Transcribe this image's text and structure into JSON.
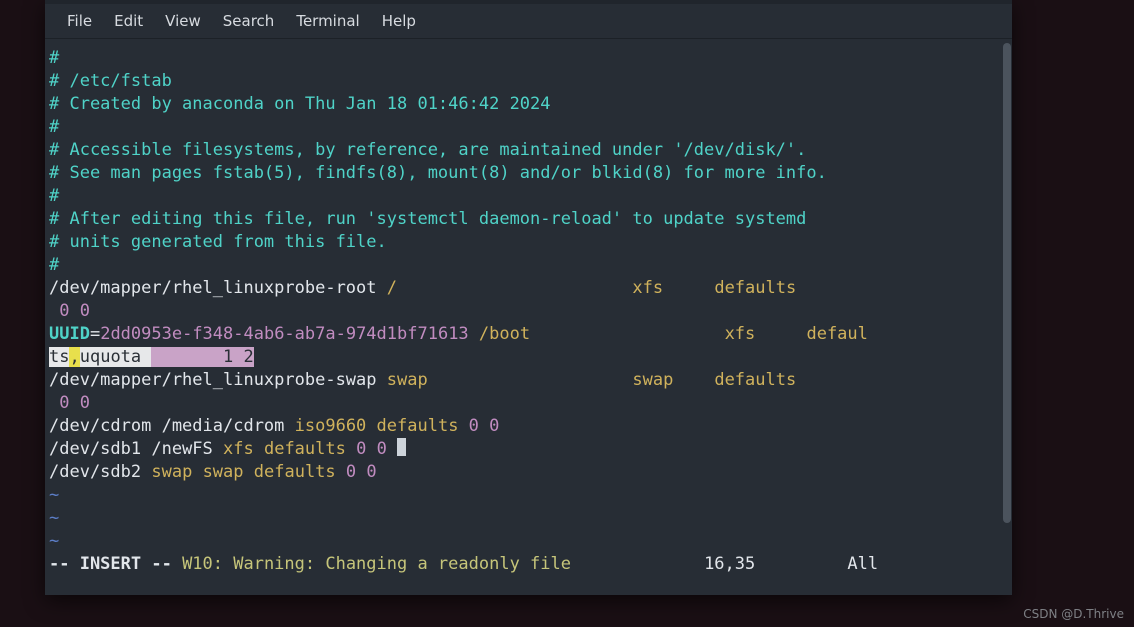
{
  "menu": {
    "file": "File",
    "edit": "Edit",
    "view": "View",
    "search": "Search",
    "terminal": "Terminal",
    "help": "Help"
  },
  "fstab": {
    "c1": "#",
    "c2": "# /etc/fstab",
    "c3": "# Created by anaconda on Thu Jan 18 01:46:42 2024",
    "c4": "#",
    "c5": "# Accessible filesystems, by reference, are maintained under '/dev/disk/'.",
    "c6": "# See man pages fstab(5), findfs(8), mount(8) and/or blkid(8) for more info.",
    "c7": "#",
    "c8": "# After editing this file, run 'systemctl daemon-reload' to update systemd",
    "c9": "# units generated from this file.",
    "c10": "#",
    "root_dev": "/dev/mapper/rhel_linuxprobe-root ",
    "root_mp": "/",
    "root_gap": "                       ",
    "root_fs": "xfs",
    "root_gap2": "     ",
    "root_opts": "defaults",
    "root_dump": " 0 ",
    "root_pass": "0",
    "uuid_key": "UUID",
    "uuid_eq": "=",
    "uuid_val": "2dd0953e-f348-4ab6-ab7a-974d1bf71613",
    "boot_mp": " /boot",
    "boot_gap": "                   ",
    "boot_fs": "xfs",
    "boot_gap2": "     ",
    "boot_opts_wrap1": "defaul",
    "boot_opts_wrap2a": "ts",
    "boot_opts_comma": ",",
    "boot_opts_wrap2b": "uquota ",
    "boot_dump_sel": "       1 2",
    "swap_dev": "/dev/mapper/rhel_linuxprobe-swap ",
    "swap_mp": "swap",
    "swap_gap": "                    ",
    "swap_fs": "swap",
    "swap_gap2": "    ",
    "swap_opts": "defaults",
    "swap_dump": " 0 ",
    "swap_pass": "0",
    "cdrom": "/dev/cdrom /media/cdrom ",
    "cdrom_fs": "iso9660",
    "cdrom_sp": " ",
    "cdrom_opts": "defaults",
    "cdrom_d1": " 0 ",
    "cdrom_d2": "0",
    "sdb1": "/dev/sdb1 /newFS ",
    "sdb1_fs": "xfs",
    "sdb1_sp": " ",
    "sdb1_opts": "defaults",
    "sdb1_d1": " 0 ",
    "sdb1_d2": "0 ",
    "sdb2": "/dev/sdb2 ",
    "sdb2_mp": "swap",
    "sdb2_sp": " ",
    "sdb2_fs": "swap",
    "sdb2_sp2": " ",
    "sdb2_opts": "defaults",
    "sdb2_d1": " 0 ",
    "sdb2_d2": "0",
    "tilde": "~"
  },
  "status": {
    "mode": "-- INSERT --",
    "warn": " W10: Warning: Changing a readonly file",
    "pos_gap": "             ",
    "pos": "16,35",
    "pct_gap": "         ",
    "pct": "All"
  },
  "watermark": "CSDN @D.Thrive"
}
